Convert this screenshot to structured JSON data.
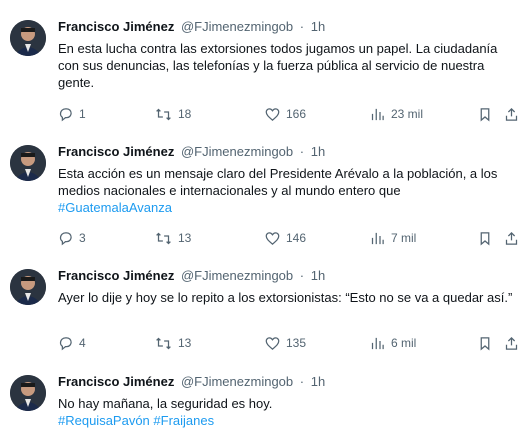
{
  "tweets": [
    {
      "name": "Francisco Jiménez",
      "handle": "@FJimenezmingob",
      "separator": "·",
      "time": "1h",
      "text": "En esta lucha contra las extorsiones todos jugamos un papel. La ciudadanía con sus denuncias, las telefonías y la fuerza pública al servicio de nuestra gente.",
      "hashtags": [],
      "replies": "1",
      "retweets": "18",
      "likes": "166",
      "views": "23 mil"
    },
    {
      "name": "Francisco Jiménez",
      "handle": "@FJimenezmingob",
      "separator": "·",
      "time": "1h",
      "text": "Esta acción es un mensaje claro del Presidente Arévalo a la población, a los medios nacionales e internacionales y al mundo entero que",
      "hashtags": [
        "#GuatemalaAvanza"
      ],
      "replies": "3",
      "retweets": "13",
      "likes": "146",
      "views": "7 mil"
    },
    {
      "name": "Francisco Jiménez",
      "handle": "@FJimenezmingob",
      "separator": "·",
      "time": "1h",
      "text": "Ayer lo dije y hoy se lo repito a los extorsionistas: “Esto no se va a quedar así.”",
      "hashtags": [],
      "replies": "4",
      "retweets": "13",
      "likes": "135",
      "views": "6 mil"
    },
    {
      "name": "Francisco Jiménez",
      "handle": "@FJimenezmingob",
      "separator": "·",
      "time": "1h",
      "text": "No hay mañana, la seguridad es hoy.",
      "hashtags": [
        "#RequisaPavón",
        "#Fraijanes"
      ]
    }
  ],
  "icons": {
    "reply": "reply-icon",
    "retweet": "retweet-icon",
    "like": "heart-icon",
    "views": "views-icon",
    "bookmark": "bookmark-icon",
    "share": "share-icon"
  },
  "colors": {
    "text": "#0f1419",
    "secondary": "#536471",
    "link": "#1d9bf0"
  }
}
